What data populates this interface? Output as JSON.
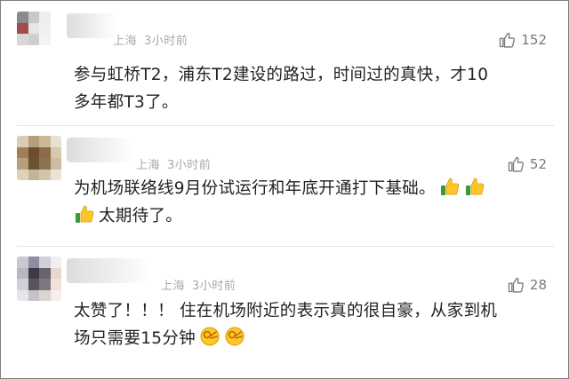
{
  "comments": [
    {
      "location": "上海",
      "time": "3小时前",
      "likes": "152",
      "lines": [
        "参与虹桥T2，浦东T2建设的路过，时间过的真快，才10",
        "多年都T3了。"
      ],
      "avatar_colors": [
        "#8a8a8a",
        "#c8c8c8",
        "#ededed",
        "#ffffff",
        "#a44a4a",
        "#e6e6e6",
        "#f0f0f0",
        "#ffffff",
        "#d8d8d8",
        "#cfcfcf",
        "#f3f3f3",
        "#ffffff",
        "#ffffff",
        "#ffffff",
        "#ffffff",
        "#ffffff"
      ]
    },
    {
      "location": "上海",
      "time": "3小时前",
      "likes": "52",
      "lines": [
        "为机场联络线9月份试运行和年底开通打下基础。",
        "太期待了。"
      ],
      "emojis_line1": [
        "thumbs-up-emoji",
        "thumbs-up-emoji"
      ],
      "emojis_line2_prefix": [
        "thumbs-up-emoji"
      ],
      "avatar_colors": [
        "#d9cdb8",
        "#b79f7c",
        "#c9b89a",
        "#e8e0d2",
        "#9f8056",
        "#6a4e2e",
        "#8c6c45",
        "#d8c9ae",
        "#b7a079",
        "#6b5232",
        "#8e7350",
        "#cdbd9f",
        "#ddd1bd",
        "#c5b493",
        "#d3c5aa",
        "#ebe3d5"
      ]
    },
    {
      "location": "上海",
      "time": "3小时前",
      "likes": "28",
      "lines": [
        "太赞了！！！ 住在机场附近的表示真的很自豪，从家到机",
        "场只需要15分钟"
      ],
      "emojis_line2": [
        "ok-hand-emoji",
        "ok-hand-emoji"
      ],
      "avatar_colors": [
        "#c9c9d3",
        "#8e8ea0",
        "#d4d0d8",
        "#f0eeee",
        "#b8b6c4",
        "#3e3a44",
        "#6a6272",
        "#e6d7cf",
        "#d2cfd6",
        "#5a5360",
        "#7e7682",
        "#f1e2d8",
        "#e9e6ea",
        "#c6c1c8",
        "#dcd4d2",
        "#f6efe9"
      ]
    }
  ]
}
